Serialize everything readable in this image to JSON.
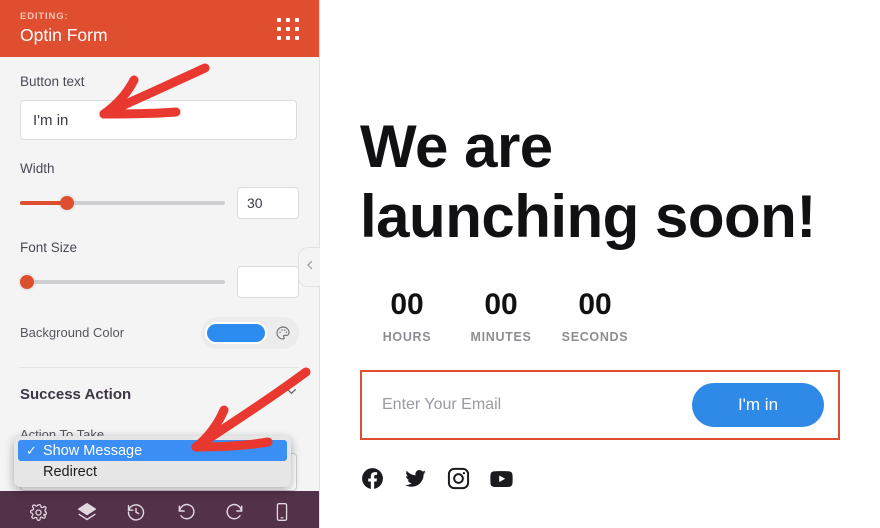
{
  "sidebar": {
    "header": {
      "editing_label": "EDITING:",
      "title": "Optin Form",
      "grid_icon": "grid-dots-icon",
      "bg_color": "#e04e30"
    },
    "fields": {
      "button_text": {
        "label": "Button text",
        "value": "I'm in",
        "placeholder": ""
      },
      "width": {
        "label": "Width",
        "value": "30",
        "slider_percent": 21
      },
      "font_size": {
        "label": "Font Size",
        "value": "",
        "slider_percent": 0
      },
      "background_color": {
        "label": "Background Color",
        "value": "#2d8cef",
        "palette_icon": "palette-icon"
      }
    },
    "success_action": {
      "title": "Success Action",
      "chevron_icon": "chevron-down-icon",
      "action_label": "Action To Take",
      "selected": "Show Message",
      "options": [
        {
          "label": "Show Message",
          "selected": true,
          "check_icon": "check-icon"
        },
        {
          "label": "Redirect",
          "selected": false,
          "check_icon": ""
        }
      ]
    },
    "collapse_handle_icon": "chevron-left-icon",
    "footer": {
      "bg_color": "#533149",
      "items": [
        {
          "icon": "gear-icon",
          "label": "Settings"
        },
        {
          "icon": "layers-icon",
          "label": "Layers"
        },
        {
          "icon": "history-icon",
          "label": "Revisions"
        },
        {
          "icon": "undo-icon",
          "label": "Undo"
        },
        {
          "icon": "redo-icon",
          "label": "Redo"
        },
        {
          "icon": "mobile-icon",
          "label": "Mobile preview"
        }
      ]
    }
  },
  "preview": {
    "headline": "We are launching soon!",
    "countdown": [
      {
        "value": "00",
        "label": "HOURS"
      },
      {
        "value": "00",
        "label": "MINUTES"
      },
      {
        "value": "00",
        "label": "SECONDS"
      }
    ],
    "optin": {
      "email_placeholder": "Enter Your Email",
      "email_value": "",
      "button_label": "I'm in",
      "button_color": "#2e8ae6",
      "selection_border_color": "#e04e30"
    },
    "socials": [
      {
        "icon": "facebook-icon",
        "label": "Facebook"
      },
      {
        "icon": "twitter-icon",
        "label": "Twitter"
      },
      {
        "icon": "instagram-icon",
        "label": "Instagram"
      },
      {
        "icon": "youtube-icon",
        "label": "YouTube"
      }
    ]
  },
  "annotations": {
    "arrow_color": "#e8382f",
    "arrows": [
      {
        "name": "arrow-to-button-text-input"
      },
      {
        "name": "arrow-to-action-dropdown"
      }
    ]
  }
}
